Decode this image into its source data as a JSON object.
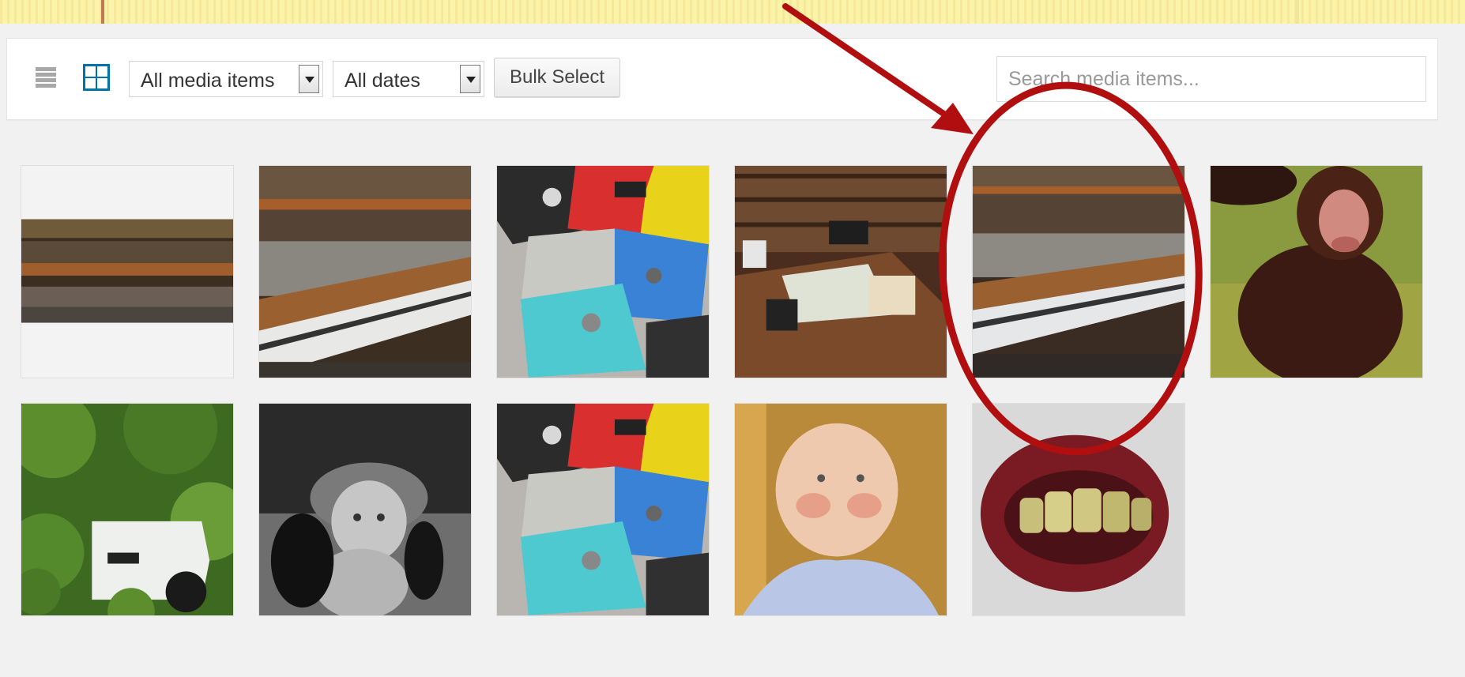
{
  "toolbar": {
    "view_list_icon": "list-view-icon",
    "view_grid_icon": "grid-view-icon",
    "type_filter": {
      "selected": "All media items"
    },
    "date_filter": {
      "selected": "All dates"
    },
    "bulk_select_label": "Bulk Select",
    "search": {
      "placeholder": "Search media items..."
    }
  },
  "colors": {
    "accent": "#0073aa",
    "annotation": "#b10f0f",
    "notice_background": "#fbf3a8"
  },
  "media_items": [
    {
      "subject": "piano"
    },
    {
      "subject": "piano"
    },
    {
      "subject": "floppy-disks"
    },
    {
      "subject": "office-desk"
    },
    {
      "subject": "piano"
    },
    {
      "subject": "chimpanzee"
    },
    {
      "subject": "jeep-in-trees"
    },
    {
      "subject": "baby-with-telephone"
    },
    {
      "subject": "floppy-disks"
    },
    {
      "subject": "baby"
    },
    {
      "subject": "false-teeth"
    }
  ]
}
